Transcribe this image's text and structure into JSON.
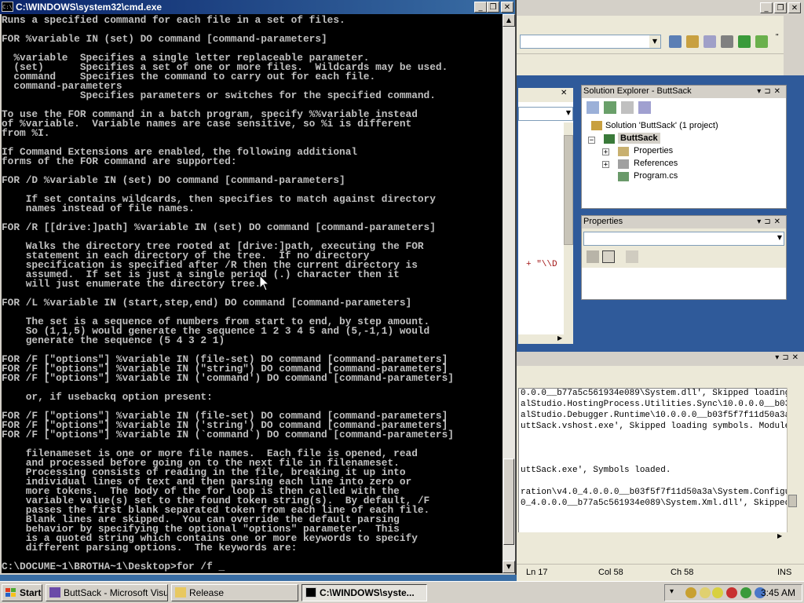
{
  "cmd": {
    "title": "C:\\WINDOWS\\system32\\cmd.exe",
    "sysicon": "C:\\",
    "lines": [
      "Runs a specified command for each file in a set of files.",
      "",
      "FOR %variable IN (set) DO command [command-parameters]",
      "",
      "  %variable  Specifies a single letter replaceable parameter.",
      "  (set)      Specifies a set of one or more files.  Wildcards may be used.",
      "  command    Specifies the command to carry out for each file.",
      "  command-parameters",
      "             Specifies parameters or switches for the specified command.",
      "",
      "To use the FOR command in a batch program, specify %%variable instead",
      "of %variable.  Variable names are case sensitive, so %i is different",
      "from %I.",
      "",
      "If Command Extensions are enabled, the following additional",
      "forms of the FOR command are supported:",
      "",
      "FOR /D %variable IN (set) DO command [command-parameters]",
      "",
      "    If set contains wildcards, then specifies to match against directory",
      "    names instead of file names.",
      "",
      "FOR /R [[drive:]path] %variable IN (set) DO command [command-parameters]",
      "",
      "    Walks the directory tree rooted at [drive:]path, executing the FOR",
      "    statement in each directory of the tree.  If no directory",
      "    specification is specified after /R then the current directory is",
      "    assumed.  If set is just a single period (.) character then it",
      "    will just enumerate the directory tree.",
      "",
      "FOR /L %variable IN (start,step,end) DO command [command-parameters]",
      "",
      "    The set is a sequence of numbers from start to end, by step amount.",
      "    So (1,1,5) would generate the sequence 1 2 3 4 5 and (5,-1,1) would",
      "    generate the sequence (5 4 3 2 1)",
      "",
      "FOR /F [\"options\"] %variable IN (file-set) DO command [command-parameters]",
      "FOR /F [\"options\"] %variable IN (\"string\") DO command [command-parameters]",
      "FOR /F [\"options\"] %variable IN ('command') DO command [command-parameters]",
      "",
      "    or, if usebackq option present:",
      "",
      "FOR /F [\"options\"] %variable IN (file-set) DO command [command-parameters]",
      "FOR /F [\"options\"] %variable IN ('string') DO command [command-parameters]",
      "FOR /F [\"options\"] %variable IN (`command`) DO command [command-parameters]",
      "",
      "    filenameset is one or more file names.  Each file is opened, read",
      "    and processed before going on to the next file in filenameset.",
      "    Processing consists of reading in the file, breaking it up into",
      "    individual lines of text and then parsing each line into zero or",
      "    more tokens.  The body of the for loop is then called with the",
      "    variable value(s) set to the found token string(s).  By default, /F",
      "    passes the first blank separated token from each line of each file.",
      "    Blank lines are skipped.  You can override the default parsing",
      "    behavior by specifying the optional \"options\" parameter.  This",
      "    is a quoted string which contains one or more keywords to specify",
      "    different parsing options.  The keywords are:",
      "",
      "C:\\DOCUME~1\\BROTHA~1\\Desktop>for /f _"
    ]
  },
  "vs": {
    "code_fragment": "+ \"\\\\D",
    "solution_explorer": {
      "title": "Solution Explorer - ButtSack",
      "solution": "Solution 'ButtSack' (1 project)",
      "project": "ButtSack",
      "items": [
        "Properties",
        "References",
        "Program.cs"
      ]
    },
    "properties": {
      "title": "Properties"
    },
    "output_lines": [
      "0.0.0__b77a5c561934e089\\System.dll', Skipped loading",
      "alStudio.HostingProcess.Utilities.Sync\\10.0.0.0__b03",
      "alStudio.Debugger.Runtime\\10.0.0.0__b03f5f7f11d50a3a",
      "uttSack.vshost.exe', Skipped loading symbols. Module",
      "",
      "",
      "",
      "",
      "uttSack.exe', Symbols loaded.",
      "",
      "ration\\v4.0_4.0.0.0__b03f5f7f11d50a3a\\System.Configu",
      "0_4.0.0.0__b77a5c561934e089\\System.Xml.dll', Skipped"
    ],
    "status": {
      "ln": "Ln 17",
      "col": "Col 58",
      "ch": "Ch 58",
      "mode": "INS"
    }
  },
  "taskbar": {
    "start": "Start",
    "tasks": [
      {
        "label": "ButtSack - Microsoft Visu...",
        "active": false
      },
      {
        "label": "Release",
        "active": false
      },
      {
        "label": "C:\\WINDOWS\\syste...",
        "active": true
      }
    ],
    "clock": "3:45 AM"
  },
  "colors": {
    "desktop": "#3a6ea5",
    "titlebar": "#0a246a",
    "console_text": "#c0c0c0",
    "console_bg": "#000000"
  },
  "icons": [
    "console-icon",
    "windows-logo-icon",
    "visual-studio-icon",
    "folder-icon",
    "solution-icon",
    "project-icon",
    "folder-icon",
    "references-icon",
    "cs-file-icon"
  ]
}
